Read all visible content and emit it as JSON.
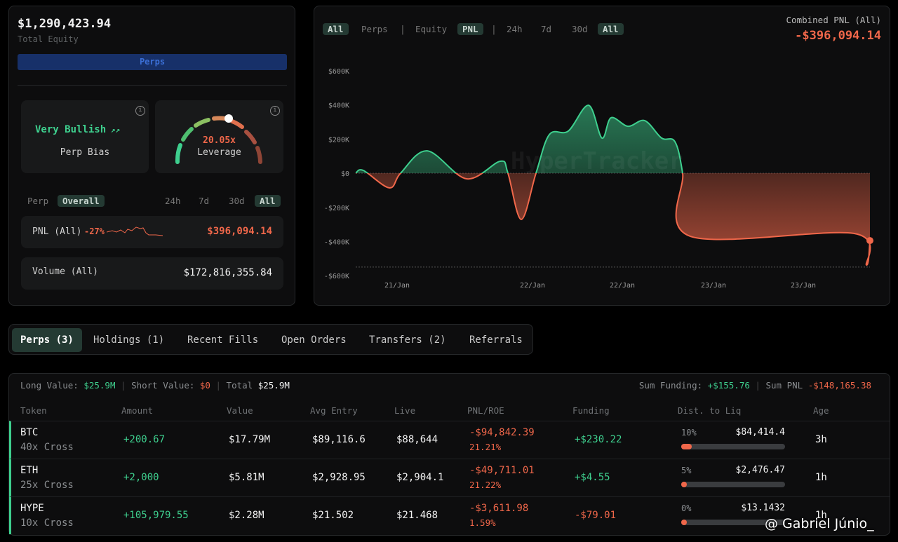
{
  "summary": {
    "total_equity": "$1,290,423.94",
    "total_equity_label": "Total Equity",
    "perps_button": "Perps",
    "bias": {
      "value": "Very Bullish",
      "trend_icon": "trending-up-icon",
      "label": "Perp Bias"
    },
    "leverage": {
      "value": "20.05x",
      "label": "Leverage",
      "gauge_level": 0.55
    },
    "filters": {
      "perp": "Perp",
      "overall": "Overall",
      "ranges": [
        "24h",
        "7d",
        "30d",
        "All"
      ],
      "active_range": "All"
    },
    "pnl": {
      "label": "PNL (All)",
      "pct": "-27%",
      "value": "$396,094.14"
    },
    "volume": {
      "label": "Volume (All)",
      "value": "$172,816,355.84"
    }
  },
  "chart_panel": {
    "toggles": {
      "all": "All",
      "perps": "Perps",
      "equity": "Equity",
      "pnl": "PNL",
      "ranges": [
        "24h",
        "7d",
        "30d",
        "All"
      ]
    },
    "combined_label": "Combined PNL (All)",
    "combined_value": "-$396,094.14",
    "watermark": "HyperTracker"
  },
  "chart_data": {
    "type": "area",
    "title": "",
    "xlabel": "",
    "ylabel": "",
    "ylim": [
      -600000,
      600000
    ],
    "yticks": [
      "$600K",
      "$400K",
      "$200K",
      "$0",
      "-$200K",
      "-$400K",
      "-$600K"
    ],
    "xticks": [
      "21/Jan",
      "22/Jan",
      "22/Jan",
      "23/Jan",
      "23/Jan"
    ],
    "values": [
      0,
      16000,
      -86000,
      0,
      131000,
      -33000,
      70000,
      0,
      -271000,
      0,
      226000,
      247000,
      398000,
      206000,
      325000,
      275000,
      308000,
      206000,
      185000,
      0,
      -370000,
      -353000,
      -538000,
      -395000
    ],
    "positive_color": "#3ecf8e",
    "negative_color": "#f0674a",
    "reference_line": -550000,
    "grid": false
  },
  "tabs": [
    {
      "label": "Perps (3)",
      "active": true
    },
    {
      "label": "Holdings (1)"
    },
    {
      "label": "Recent Fills"
    },
    {
      "label": "Open Orders"
    },
    {
      "label": "Transfers (2)"
    },
    {
      "label": "Referrals"
    }
  ],
  "positions": {
    "summary": {
      "long_label": "Long Value:",
      "long": "$25.9M",
      "short_label": "Short Value:",
      "short": "$0",
      "total_label": "Total",
      "total": "$25.9M",
      "funding_label": "Sum Funding:",
      "funding": "+$155.76",
      "pnl_label": "Sum PNL",
      "pnl": "-$148,165.38"
    },
    "columns": [
      "Token",
      "Amount",
      "Value",
      "Avg Entry",
      "Live",
      "PNL/ROE",
      "Funding",
      "Dist. to Liq",
      "Age"
    ],
    "rows": [
      {
        "token": "BTC",
        "lev": "40x Cross",
        "amount": "+200.67",
        "value": "$17.79M",
        "entry": "$89,116.6",
        "live": "$88,644",
        "pnl": "-$94,842.39",
        "roe": "21.21%",
        "funding": "+$230.22",
        "funding_pos": true,
        "dist": "10%",
        "liq": "$84,414.4",
        "dist_frac": 0.1,
        "age": "3h"
      },
      {
        "token": "ETH",
        "lev": "25x Cross",
        "amount": "+2,000",
        "value": "$5.81M",
        "entry": "$2,928.95",
        "live": "$2,904.1",
        "pnl": "-$49,711.01",
        "roe": "21.22%",
        "funding": "+$4.55",
        "funding_pos": true,
        "dist": "5%",
        "liq": "$2,476.47",
        "dist_frac": 0.05,
        "age": "1h"
      },
      {
        "token": "HYPE",
        "lev": "10x Cross",
        "amount": "+105,979.55",
        "value": "$2.28M",
        "entry": "$21.502",
        "live": "$21.468",
        "pnl": "-$3,611.98",
        "roe": "1.59%",
        "funding": "-$79.01",
        "funding_pos": false,
        "dist": "0%",
        "liq": "$13.1432",
        "dist_frac": 0,
        "age": "1h"
      }
    ]
  },
  "watermark_credit": "@ Gabriel Júnio_"
}
